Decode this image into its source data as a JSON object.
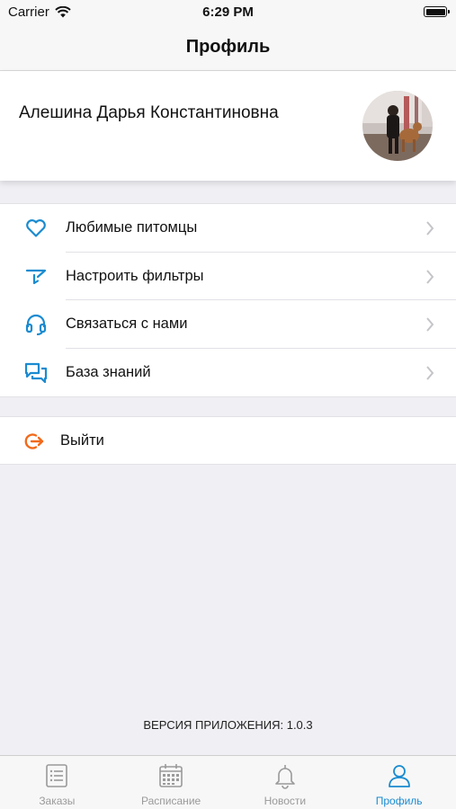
{
  "status_bar": {
    "carrier": "Carrier",
    "time": "6:29 PM"
  },
  "nav": {
    "title": "Профиль"
  },
  "profile": {
    "name": "Алешина Дарья Константиновна"
  },
  "menu": {
    "items": [
      {
        "label": "Любимые питомцы",
        "icon": "heart-icon"
      },
      {
        "label": "Настроить фильтры",
        "icon": "filter-icon"
      },
      {
        "label": "Связаться с нами",
        "icon": "headset-icon"
      },
      {
        "label": "База знаний",
        "icon": "chat-bubbles-icon"
      }
    ]
  },
  "logout": {
    "label": "Выйти",
    "icon": "logout-icon"
  },
  "footer": {
    "version": "ВЕРСИЯ ПРИЛОЖЕНИЯ: 1.0.3"
  },
  "tabs": [
    {
      "label": "Заказы",
      "icon": "list-icon"
    },
    {
      "label": "Расписание",
      "icon": "calendar-icon"
    },
    {
      "label": "Новости",
      "icon": "bell-icon"
    },
    {
      "label": "Профиль",
      "icon": "person-icon",
      "active": true
    }
  ],
  "colors": {
    "accent": "#1a8bd0",
    "logout": "#f26a1b",
    "inactive": "#9a9a9a",
    "background": "#efeff4"
  }
}
